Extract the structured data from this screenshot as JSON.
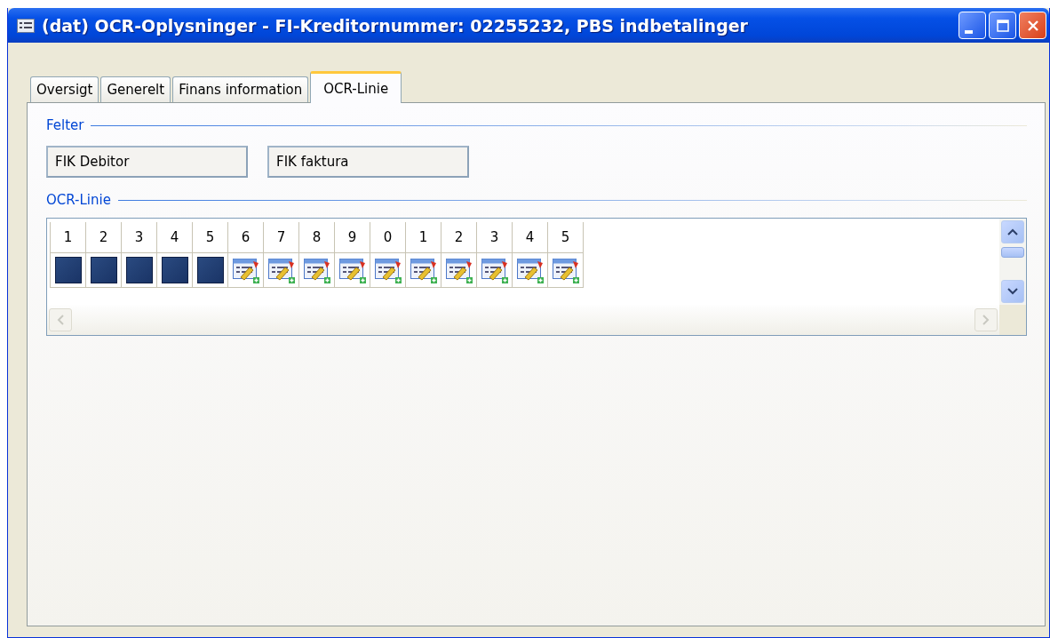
{
  "window": {
    "title": "(dat) OCR-Oplysninger - FI-Kreditornummer: 02255232, PBS indbetalinger"
  },
  "tabs": [
    {
      "label": "Oversigt",
      "selected": false
    },
    {
      "label": "Generelt",
      "selected": false
    },
    {
      "label": "Finans information",
      "selected": false
    },
    {
      "label": "OCR-Linie",
      "selected": true
    }
  ],
  "felter": {
    "heading": "Felter",
    "fields": [
      {
        "value": "FIK Debitor"
      },
      {
        "value": "FIK faktura"
      }
    ]
  },
  "ocr_line": {
    "heading": "OCR-Linie",
    "columns": [
      {
        "label": "1",
        "kind": "filled"
      },
      {
        "label": "2",
        "kind": "filled"
      },
      {
        "label": "3",
        "kind": "filled"
      },
      {
        "label": "4",
        "kind": "filled"
      },
      {
        "label": "5",
        "kind": "filled"
      },
      {
        "label": "6",
        "kind": "field"
      },
      {
        "label": "7",
        "kind": "field"
      },
      {
        "label": "8",
        "kind": "field"
      },
      {
        "label": "9",
        "kind": "field"
      },
      {
        "label": "0",
        "kind": "field"
      },
      {
        "label": "1",
        "kind": "field"
      },
      {
        "label": "2",
        "kind": "field"
      },
      {
        "label": "3",
        "kind": "field"
      },
      {
        "label": "4",
        "kind": "field"
      },
      {
        "label": "5",
        "kind": "field"
      }
    ]
  }
}
